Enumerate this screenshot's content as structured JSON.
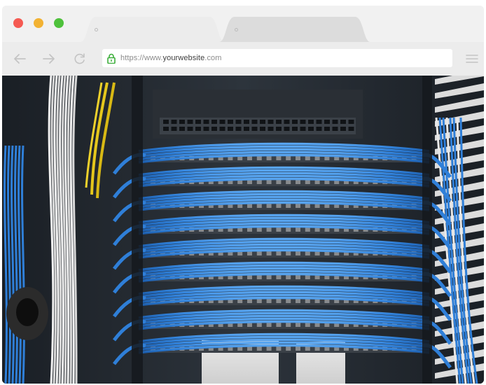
{
  "browser": {
    "url_prefix": "https://www.",
    "url_host": "yourwebsite",
    "url_suffix": ".com"
  },
  "colors": {
    "close": "#f55a52",
    "minimize": "#f2b233",
    "maximize": "#4ec13b",
    "lock": "#3cae3a",
    "cable_blue": "#2f7fd8"
  },
  "icons": [
    "back-arrow-icon",
    "forward-arrow-icon",
    "reload-icon",
    "lock-icon",
    "hamburger-menu-icon"
  ],
  "content": {
    "image_subject": "server rack patch panel with blue network cables"
  }
}
